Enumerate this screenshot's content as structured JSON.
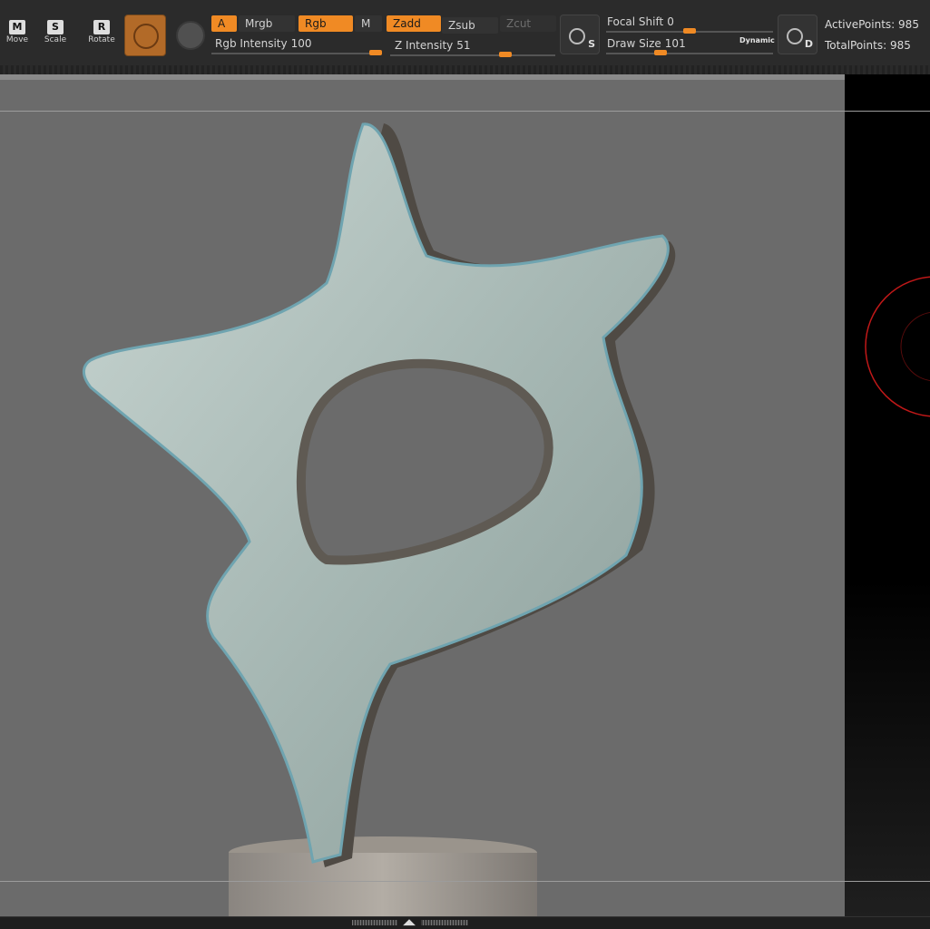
{
  "toolbar": {
    "tools": {
      "move": {
        "label": "Move",
        "key": "M"
      },
      "scale": {
        "label": "Scale",
        "key": "S"
      },
      "rotate": {
        "label": "Rotate",
        "key": "R"
      }
    },
    "modes": {
      "a": "A",
      "mrgb": "Mrgb",
      "rgb": "Rgb",
      "m": "M",
      "zadd": "Zadd",
      "zsub": "Zsub",
      "zcut": "Zcut"
    },
    "rgb_intensity": {
      "label": "Rgb Intensity",
      "value": "100"
    },
    "z_intensity": {
      "label": "Z Intensity",
      "value": "51"
    },
    "focal_shift": {
      "label": "Focal Shift",
      "value": "0"
    },
    "draw_size": {
      "label": "Draw Size",
      "value": "101"
    },
    "dynamic_label": "Dynamic",
    "stroke_icon_letter": "S",
    "draw_icon_letter": "D",
    "active_points": {
      "label": "ActivePoints:",
      "value": "985"
    },
    "total_points": {
      "label": "TotalPoints:",
      "value": "985"
    }
  },
  "bottom": {
    "arrows": "◢◣"
  }
}
